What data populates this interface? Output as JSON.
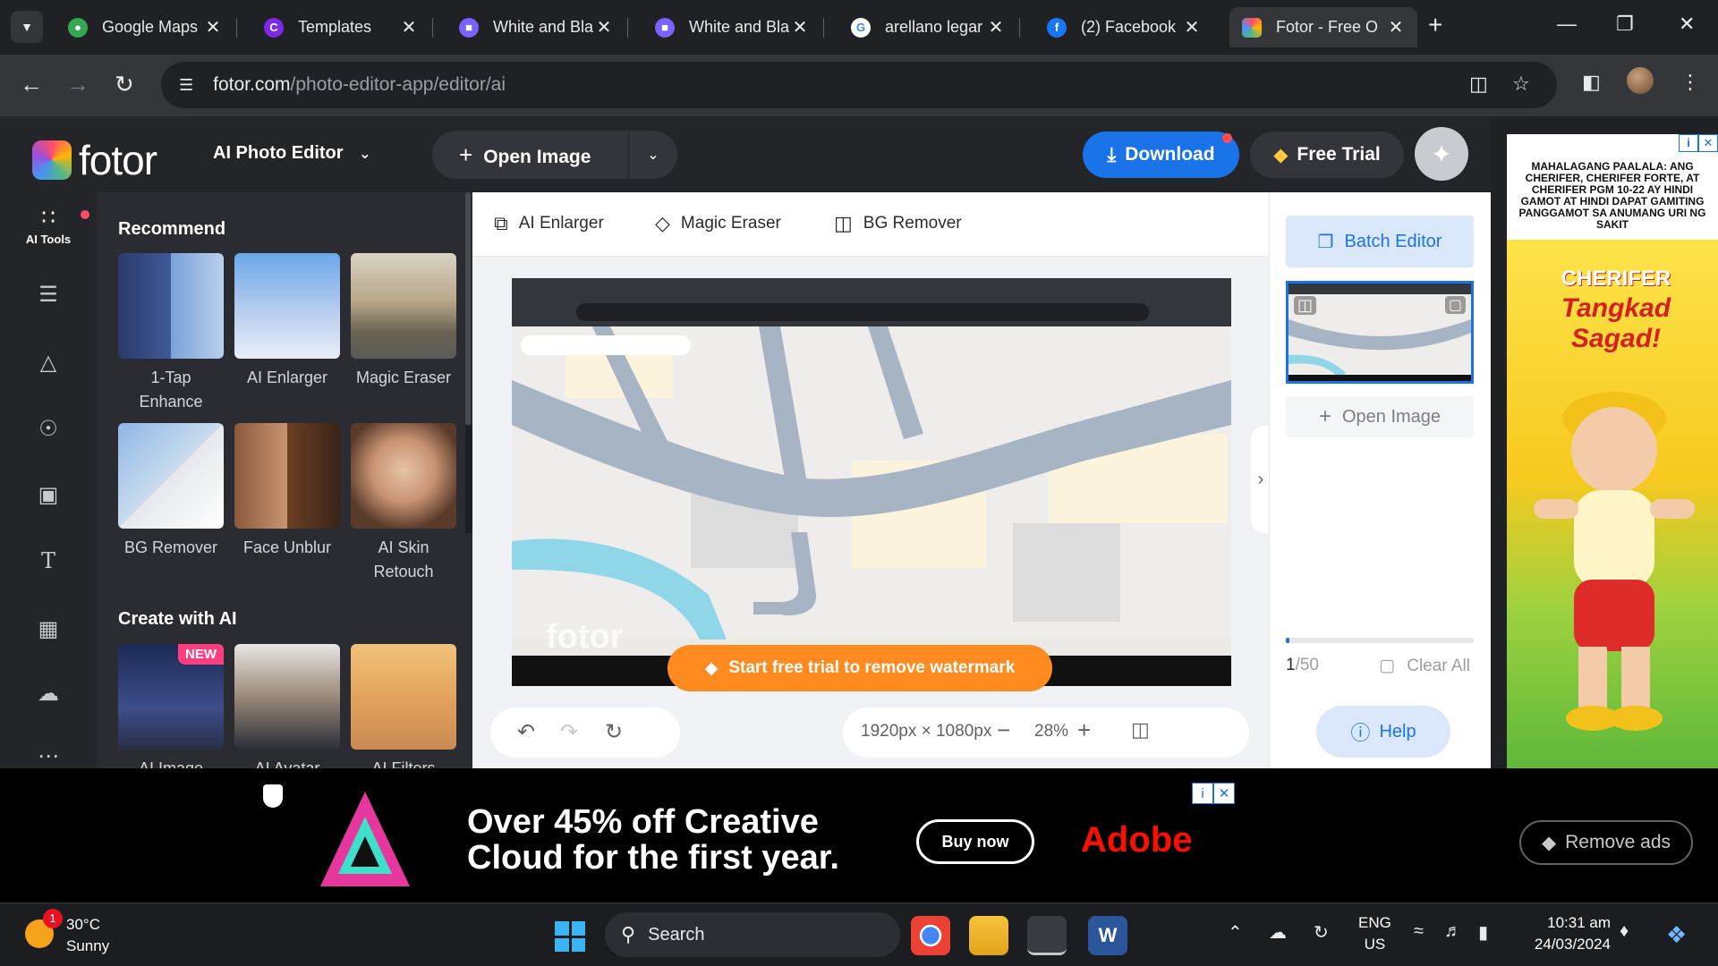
{
  "browser": {
    "tabs": [
      {
        "title": "Google Maps",
        "favicon_color": "#34a853",
        "favicon_glyph": "●"
      },
      {
        "title": "Templates",
        "favicon_color": "#7d2ae8",
        "favicon_glyph": "C"
      },
      {
        "title": "White and Bla",
        "favicon_color": "#7b61ff",
        "favicon_glyph": "■"
      },
      {
        "title": "White and Bla",
        "favicon_color": "#7b61ff",
        "favicon_glyph": "■"
      },
      {
        "title": "arellano legar",
        "favicon_color": "#ffffff",
        "favicon_glyph": "G"
      },
      {
        "title": "(2) Facebook",
        "favicon_color": "#1877f2",
        "favicon_glyph": "f"
      },
      {
        "title": "Fotor - Free O",
        "favicon_color": "#ff7a3d",
        "favicon_glyph": "■"
      }
    ],
    "url_domain": "fotor.com",
    "url_path": "/photo-editor-app/editor/ai"
  },
  "header": {
    "logo_text": "fotor",
    "app_switch_label": "AI Photo Editor",
    "open_image_label": "Open Image",
    "download_label": "Download",
    "free_trial_label": "Free Trial"
  },
  "rail": {
    "active_label": "AI Tools"
  },
  "panel": {
    "recommend_title": "Recommend",
    "recommend_tools": [
      {
        "label": "1-Tap Enhance"
      },
      {
        "label": "AI Enlarger"
      },
      {
        "label": "Magic Eraser"
      },
      {
        "label": "BG Remover"
      },
      {
        "label": "Face Unblur"
      },
      {
        "label": "AI Skin Retouch"
      }
    ],
    "create_title": "Create with AI",
    "create_tools": [
      {
        "label": "AI Image",
        "badge": "NEW"
      },
      {
        "label": "AI Avatar"
      },
      {
        "label": "AI Filters"
      }
    ]
  },
  "canvas_toolbar": {
    "tools": [
      "AI Enlarger",
      "Magic Eraser",
      "BG Remover"
    ]
  },
  "canvas": {
    "watermark_text": "fotor",
    "watermark_cta": "Start free trial to remove watermark",
    "dimensions": "1920px × 1080px",
    "zoom": "28%"
  },
  "right_panel": {
    "batch_label": "Batch Editor",
    "open_image_label": "Open Image",
    "count_current": "1",
    "count_total": "/50",
    "progress_fraction": 0.02,
    "clear_label": "Clear All",
    "help_label": "Help"
  },
  "right_ad": {
    "top_text": "MAHALAGANG PAALALA: ANG CHERIFER, CHERIFER FORTE, AT CHERIFER PGM 10-22 AY HINDI GAMOT AT HINDI DAPAT GAMITING PANGGAMOT SA ANUMANG URI NG SAKIT",
    "brand": "CHERIFER",
    "tagline": "Tangkad Sagad!"
  },
  "bottom_ad": {
    "headline_line1": "Over 45% off Creative",
    "headline_line2": "Cloud for the first year.",
    "cta": "Buy now",
    "brand": "Adobe",
    "remove_ads_label": "Remove ads"
  },
  "taskbar": {
    "temperature": "30°C",
    "condition": "Sunny",
    "weather_badge": "1",
    "search_label": "Search",
    "lang_line1": "ENG",
    "lang_line2": "US",
    "time": "10:31 am",
    "date": "24/03/2024"
  },
  "colors": {
    "accent": "#1a73e8",
    "watermark_bar": "#ff8a1f",
    "new_badge": "#ff3e7f",
    "adobe_red": "#fa0f00"
  }
}
